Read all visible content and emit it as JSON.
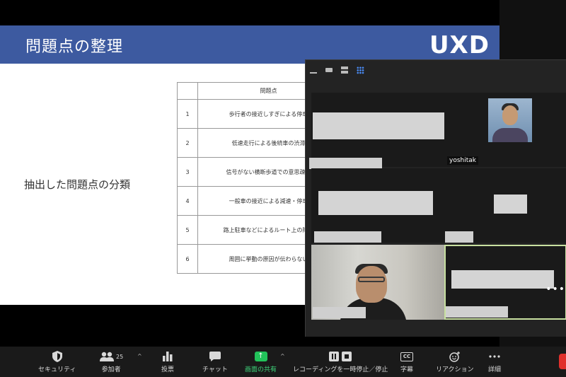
{
  "slide": {
    "title": "問題点の整理",
    "logo": "UXD",
    "subtitle": "抽出した問題点の分類",
    "table": {
      "header": "問題点",
      "rows": [
        {
          "num": "1",
          "text": "歩行者の接近しすぎによる停車"
        },
        {
          "num": "2",
          "text": "低速走行による後続車の渋滞"
        },
        {
          "num": "3",
          "text": "信号がない横断歩道での意思疎通"
        },
        {
          "num": "4",
          "text": "一般車の接近による減速・停車"
        },
        {
          "num": "5",
          "text": "路上駐車などによるルート上の障害"
        },
        {
          "num": "6",
          "text": "周囲に挙動の原因が伝わらない"
        }
      ]
    }
  },
  "gallery": {
    "participant_name": "yoshitak",
    "more": "•••"
  },
  "toolbar": {
    "security": "セキュリティ",
    "participants": "参加者",
    "participants_count": "25",
    "polls": "投票",
    "chat": "チャット",
    "share": "画面の共有",
    "recording": "レコーディングを一時停止／停止",
    "captions": "字幕",
    "captions_icon": "CC",
    "reactions": "リアクション",
    "more": "詳細",
    "caret": "^"
  },
  "colors": {
    "slide_header": "#3d5aa0",
    "share_green": "#22c25a",
    "active_outline": "#c8e0a0",
    "end_red": "#e0302c"
  }
}
